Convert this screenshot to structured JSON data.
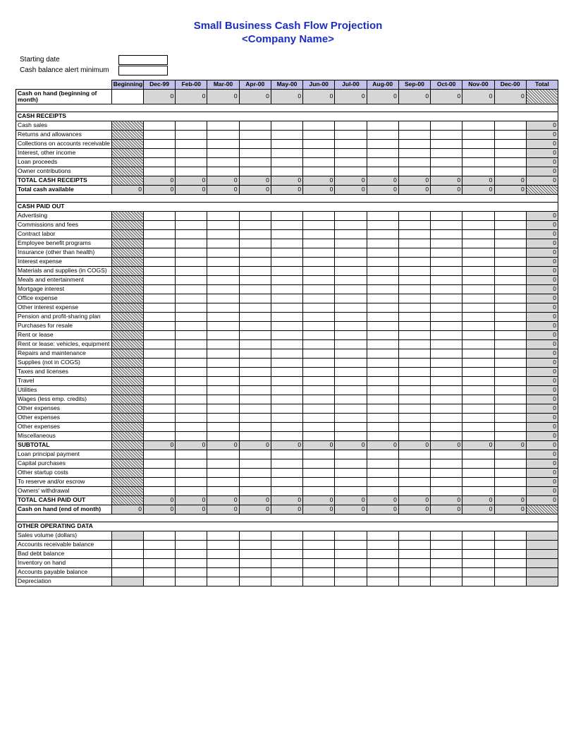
{
  "title1": "Small Business Cash Flow Projection",
  "title2": "<Company Name>",
  "meta": {
    "starting_date_label": "Starting date",
    "cash_balance_alert_label": "Cash balance alert minimum"
  },
  "headers": [
    "Beginning",
    "Dec-99",
    "Feb-00",
    "Mar-00",
    "Apr-00",
    "May-00",
    "Jun-00",
    "Jul-00",
    "Aug-00",
    "Sep-00",
    "Oct-00",
    "Nov-00",
    "Dec-00",
    "Total"
  ],
  "cash_on_hand_label": "Cash on hand (beginning of month)",
  "zero": "0",
  "sections": {
    "receipts": {
      "title": "CASH RECEIPTS",
      "rows": [
        "Cash sales",
        "Returns and allowances",
        "Collections on accounts receivable",
        "Interest, other income",
        "Loan proceeds",
        "Owner contributions"
      ],
      "total_label": "TOTAL CASH RECEIPTS",
      "available_label": "Total cash available"
    },
    "paidout": {
      "title": "CASH PAID OUT",
      "rows": [
        "Advertising",
        "Commissions and fees",
        "Contract labor",
        "Employee benefit programs",
        "Insurance (other than health)",
        "Interest expense",
        "Materials and supplies (in COGS)",
        "Meals and entertainment",
        "Mortgage interest",
        "Office expense",
        "Other interest expense",
        "Pension and profit-sharing plan",
        "Purchases for resale",
        "Rent or lease",
        "Rent or lease: vehicles, equipment",
        "Repairs and maintenance",
        "Supplies (not in COGS)",
        "Taxes and licenses",
        "Travel",
        "Utilities",
        "Wages (less emp. credits)",
        "Other expenses",
        "Other expenses",
        "Other expenses",
        "Miscellaneous"
      ],
      "subtotal_label": "SUBTOTAL",
      "extra_rows": [
        "Loan principal payment",
        "Capital purchases",
        "Other startup costs",
        "To reserve and/or escrow",
        "Owners' withdrawal"
      ],
      "total_label": "TOTAL CASH PAID OUT",
      "end_label": "Cash on hand (end of month)"
    },
    "other": {
      "title": "OTHER OPERATING DATA",
      "rows": [
        "Sales volume (dollars)",
        "Accounts receivable balance",
        "Bad debt balance",
        "Inventory on hand",
        "Accounts payable balance",
        "Depreciation"
      ]
    }
  }
}
